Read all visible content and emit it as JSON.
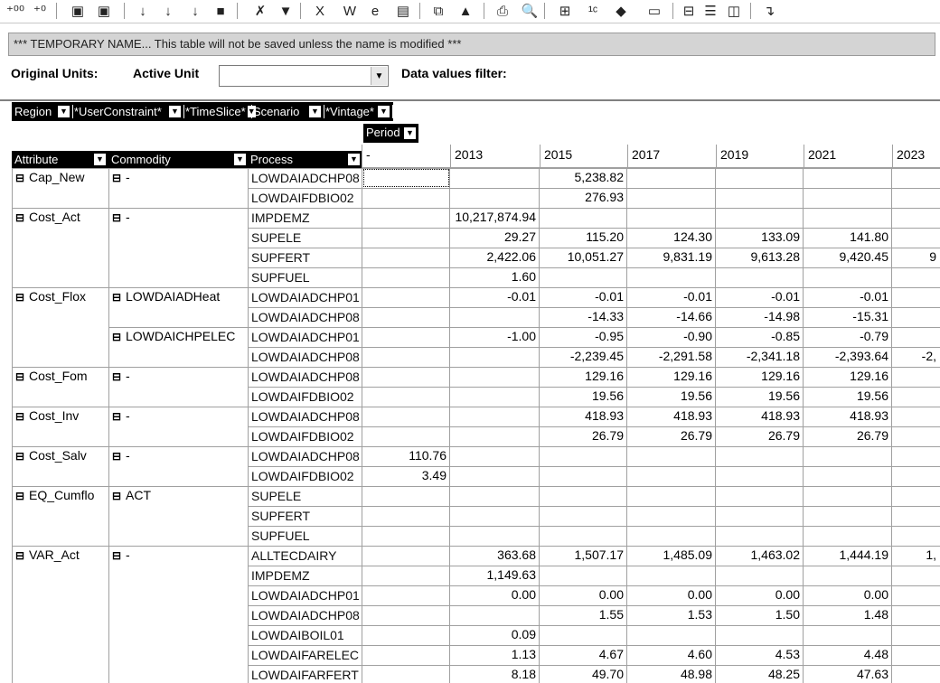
{
  "toolbar": {
    "buttons": [
      {
        "name": "decimal-increase-icon",
        "glyph": "⁺⁰⁰"
      },
      {
        "name": "decimal-decrease-icon",
        "glyph": "⁺⁰"
      },
      {
        "name": "save-icon",
        "glyph": "▣"
      },
      {
        "name": "save-all-icon",
        "glyph": "▣"
      },
      {
        "name": "sort-ascending-icon",
        "glyph": "↓"
      },
      {
        "name": "sort-descending-icon",
        "glyph": "↓"
      },
      {
        "name": "sort-custom-icon",
        "glyph": "↓"
      },
      {
        "name": "blank-icon",
        "glyph": "■"
      },
      {
        "name": "clear-filter-icon",
        "glyph": "✗"
      },
      {
        "name": "filter-icon",
        "glyph": "▼"
      },
      {
        "name": "excel-icon",
        "glyph": "X"
      },
      {
        "name": "word-icon",
        "glyph": "W"
      },
      {
        "name": "browser-icon",
        "glyph": "e"
      },
      {
        "name": "notes-icon",
        "glyph": "▤"
      },
      {
        "name": "copy-icon",
        "glyph": "⧉"
      },
      {
        "name": "chart-icon",
        "glyph": "▲"
      },
      {
        "name": "print-icon",
        "glyph": "⎙"
      },
      {
        "name": "print-preview-icon",
        "glyph": "🔍"
      },
      {
        "name": "pivot-icon",
        "glyph": "⊞"
      },
      {
        "name": "units-icon",
        "glyph": "¹ᶜ"
      },
      {
        "name": "fill-color-icon",
        "glyph": "◆"
      },
      {
        "name": "layout-icon",
        "glyph": "▭"
      },
      {
        "name": "split-horizontal-icon",
        "glyph": "⊟"
      },
      {
        "name": "split-rows-icon",
        "glyph": "☰"
      },
      {
        "name": "split-columns-icon",
        "glyph": "◫"
      },
      {
        "name": "exit-icon",
        "glyph": "↴"
      }
    ]
  },
  "temp_message": "*** TEMPORARY NAME... This table will not be saved unless the name is modified ***",
  "labels": {
    "original_units": "Original Units:",
    "active_unit": "Active Unit",
    "data_values_filter": "Data values filter:"
  },
  "active_unit_value": "",
  "filters": [
    "Region",
    "*UserConstraint*",
    "*TimeSlice*",
    "Scenario",
    "*Vintage*"
  ],
  "period_header": "Period",
  "row_headers": [
    "Attribute",
    "Commodity",
    "Process"
  ],
  "columns": [
    "-",
    "2013",
    "2015",
    "2017",
    "2019",
    "2021",
    "2023"
  ],
  "rows": [
    {
      "attr": "Cap_New",
      "comm": "-",
      "proc": "LOWDAIADCHP08",
      "v": [
        "",
        "",
        "5,238.82",
        "",
        "",
        "",
        ""
      ]
    },
    {
      "attr": "",
      "comm": "",
      "proc": "LOWDAIFDBIO02",
      "v": [
        "",
        "",
        "276.93",
        "",
        "",
        "",
        ""
      ]
    },
    {
      "attr": "Cost_Act",
      "comm": "-",
      "proc": "IMPDEMZ",
      "v": [
        "",
        "10,217,874.94",
        "",
        "",
        "",
        "",
        ""
      ]
    },
    {
      "attr": "",
      "comm": "",
      "proc": "SUPELE",
      "v": [
        "",
        "29.27",
        "115.20",
        "124.30",
        "133.09",
        "141.80",
        ""
      ]
    },
    {
      "attr": "",
      "comm": "",
      "proc": "SUPFERT",
      "v": [
        "",
        "2,422.06",
        "10,051.27",
        "9,831.19",
        "9,613.28",
        "9,420.45",
        "9"
      ]
    },
    {
      "attr": "",
      "comm": "",
      "proc": "SUPFUEL",
      "v": [
        "",
        "1.60",
        "",
        "",
        "",
        "",
        ""
      ]
    },
    {
      "attr": "Cost_Flox",
      "comm": "LOWDAIADHeat",
      "proc": "LOWDAIADCHP01",
      "v": [
        "",
        "-0.01",
        "-0.01",
        "-0.01",
        "-0.01",
        "-0.01",
        ""
      ]
    },
    {
      "attr": "",
      "comm": "",
      "proc": "LOWDAIADCHP08",
      "v": [
        "",
        "",
        "-14.33",
        "-14.66",
        "-14.98",
        "-15.31",
        ""
      ]
    },
    {
      "attr": "",
      "comm": "LOWDAICHPELEC",
      "proc": "LOWDAIADCHP01",
      "v": [
        "",
        "-1.00",
        "-0.95",
        "-0.90",
        "-0.85",
        "-0.79",
        ""
      ]
    },
    {
      "attr": "",
      "comm": "",
      "proc": "LOWDAIADCHP08",
      "v": [
        "",
        "",
        "-2,239.45",
        "-2,291.58",
        "-2,341.18",
        "-2,393.64",
        "-2,"
      ]
    },
    {
      "attr": "Cost_Fom",
      "comm": "-",
      "proc": "LOWDAIADCHP08",
      "v": [
        "",
        "",
        "129.16",
        "129.16",
        "129.16",
        "129.16",
        ""
      ]
    },
    {
      "attr": "",
      "comm": "",
      "proc": "LOWDAIFDBIO02",
      "v": [
        "",
        "",
        "19.56",
        "19.56",
        "19.56",
        "19.56",
        ""
      ]
    },
    {
      "attr": "Cost_Inv",
      "comm": "-",
      "proc": "LOWDAIADCHP08",
      "v": [
        "",
        "",
        "418.93",
        "418.93",
        "418.93",
        "418.93",
        ""
      ]
    },
    {
      "attr": "",
      "comm": "",
      "proc": "LOWDAIFDBIO02",
      "v": [
        "",
        "",
        "26.79",
        "26.79",
        "26.79",
        "26.79",
        ""
      ]
    },
    {
      "attr": "Cost_Salv",
      "comm": "-",
      "proc": "LOWDAIADCHP08",
      "v": [
        "110.76",
        "",
        "",
        "",
        "",
        "",
        ""
      ]
    },
    {
      "attr": "",
      "comm": "",
      "proc": "LOWDAIFDBIO02",
      "v": [
        "3.49",
        "",
        "",
        "",
        "",
        "",
        ""
      ]
    },
    {
      "attr": "EQ_Cumflo",
      "comm": "ACT",
      "proc": "SUPELE",
      "v": [
        "",
        "",
        "",
        "",
        "",
        "",
        ""
      ]
    },
    {
      "attr": "",
      "comm": "",
      "proc": "SUPFERT",
      "v": [
        "",
        "",
        "",
        "",
        "",
        "",
        ""
      ]
    },
    {
      "attr": "",
      "comm": "",
      "proc": "SUPFUEL",
      "v": [
        "",
        "",
        "",
        "",
        "",
        "",
        ""
      ]
    },
    {
      "attr": "VAR_Act",
      "comm": "-",
      "proc": "ALLTECDAIRY",
      "v": [
        "",
        "363.68",
        "1,507.17",
        "1,485.09",
        "1,463.02",
        "1,444.19",
        "1,"
      ]
    },
    {
      "attr": "",
      "comm": "",
      "proc": "IMPDEMZ",
      "v": [
        "",
        "1,149.63",
        "",
        "",
        "",
        "",
        ""
      ]
    },
    {
      "attr": "",
      "comm": "",
      "proc": "LOWDAIADCHP01",
      "v": [
        "",
        "0.00",
        "0.00",
        "0.00",
        "0.00",
        "0.00",
        ""
      ]
    },
    {
      "attr": "",
      "comm": "",
      "proc": "LOWDAIADCHP08",
      "v": [
        "",
        "",
        "1.55",
        "1.53",
        "1.50",
        "1.48",
        ""
      ]
    },
    {
      "attr": "",
      "comm": "",
      "proc": "LOWDAIBOIL01",
      "v": [
        "",
        "0.09",
        "",
        "",
        "",
        "",
        ""
      ]
    },
    {
      "attr": "",
      "comm": "",
      "proc": "LOWDAIFARELEC",
      "v": [
        "",
        "1.13",
        "4.67",
        "4.60",
        "4.53",
        "4.48",
        ""
      ]
    },
    {
      "attr": "",
      "comm": "",
      "proc": "LOWDAIFARFERT",
      "v": [
        "",
        "8.18",
        "49.70",
        "48.98",
        "48.25",
        "47.63",
        ""
      ]
    }
  ]
}
